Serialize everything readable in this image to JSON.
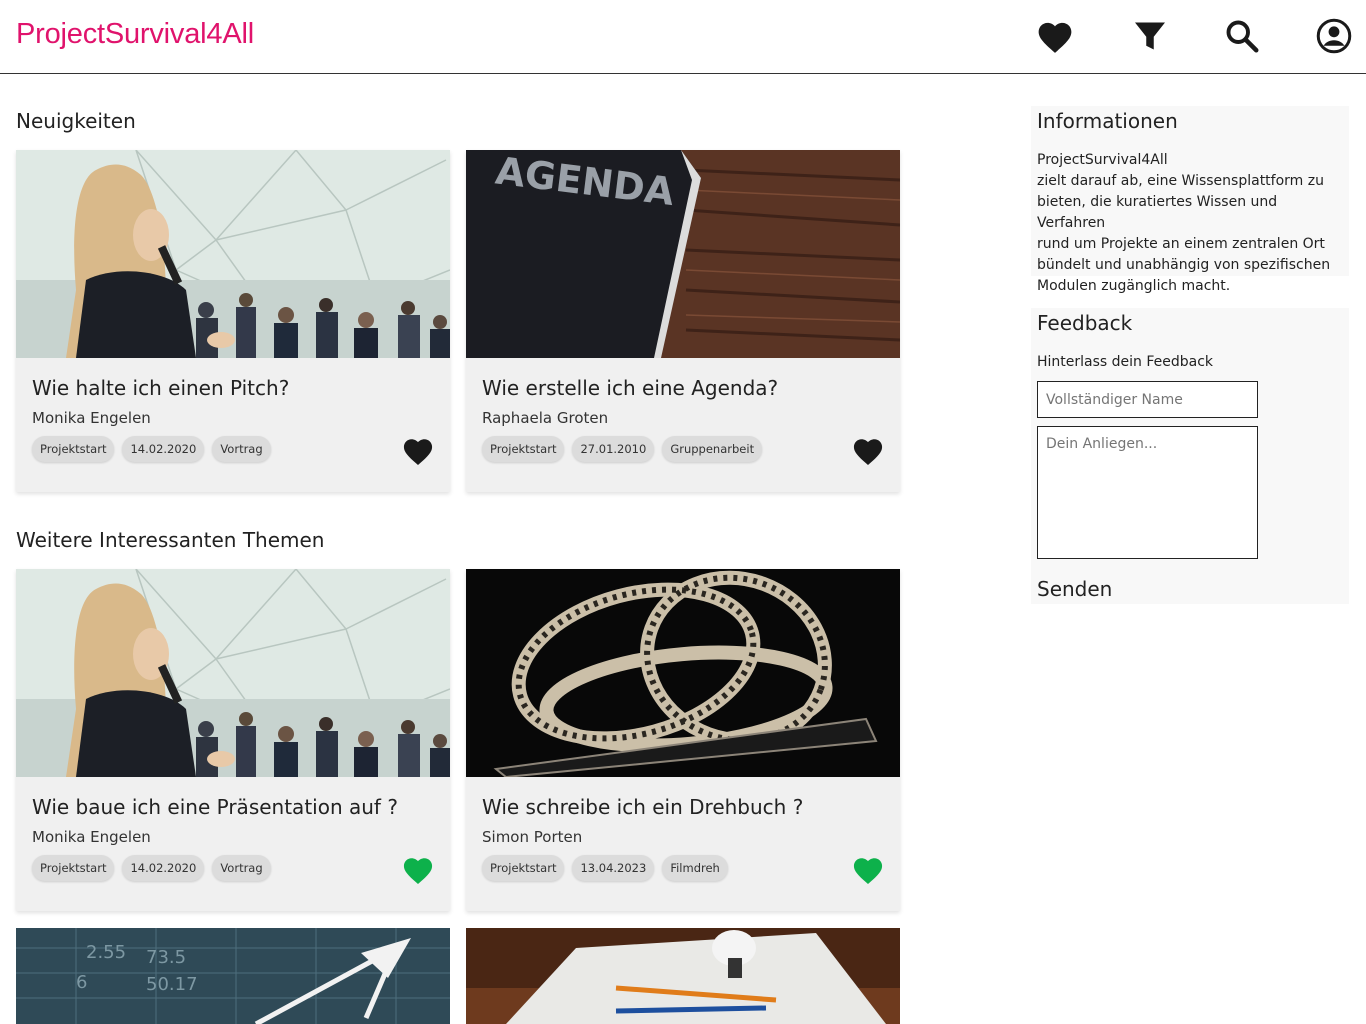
{
  "header": {
    "brand": "ProjectSurvival4All",
    "icons": [
      "heart-icon",
      "filter-icon",
      "search-icon",
      "account-icon"
    ],
    "brand_color": "#e0136c"
  },
  "news": {
    "heading": "Neuigkeiten",
    "cards": [
      {
        "image": "presentation-photo",
        "title": "Wie halte ich einen Pitch?",
        "author": "Monika Engelen",
        "tags": [
          "Projektstart",
          "14.02.2020",
          "Vortrag"
        ],
        "favorite": false
      },
      {
        "image": "agenda-book-photo",
        "image_text": "AGENDA",
        "title": "Wie erstelle ich eine Agenda?",
        "author": "Raphaela Groten",
        "tags": [
          "Projektstart",
          "27.01.2010",
          "Gruppenarbeit"
        ],
        "favorite": false
      }
    ]
  },
  "more": {
    "heading": "Weitere Interessanten Themen",
    "cards": [
      {
        "image": "presentation-photo",
        "title": "Wie baue ich eine Präsentation auf ?",
        "author": "Monika Engelen",
        "tags": [
          "Projektstart",
          "14.02.2020",
          "Vortrag"
        ],
        "favorite": true
      },
      {
        "image": "film-reel-photo",
        "title": "Wie schreibe ich ein Drehbuch ?",
        "author": "Simon Porten",
        "tags": [
          "Projektstart",
          "13.04.2023",
          "Filmdreh"
        ],
        "favorite": true
      }
    ],
    "partial_cards": [
      "chart-arrow-photo",
      "pencil-bulb-photo"
    ]
  },
  "colors": {
    "favorite_on": "#0db14b",
    "favorite_off": "#1a1a1a"
  },
  "sidebar": {
    "info": {
      "title": "Informationen",
      "lines": [
        "ProjectSurvival4All",
        "zielt darauf ab, eine Wissensplattform zu",
        "bieten, die kuratiertes Wissen und  Verfahren",
        "rund um Projekte   an einem zentralen Ort",
        "bündelt und unabhängig von spezifischen",
        "Modulen zugänglich macht."
      ]
    },
    "feedback": {
      "title": "Feedback",
      "subtitle": "Hinterlass dein Feedback",
      "name_placeholder": "Vollständiger Name",
      "message_placeholder": "Dein Anliegen...",
      "send_label": "Senden"
    }
  }
}
